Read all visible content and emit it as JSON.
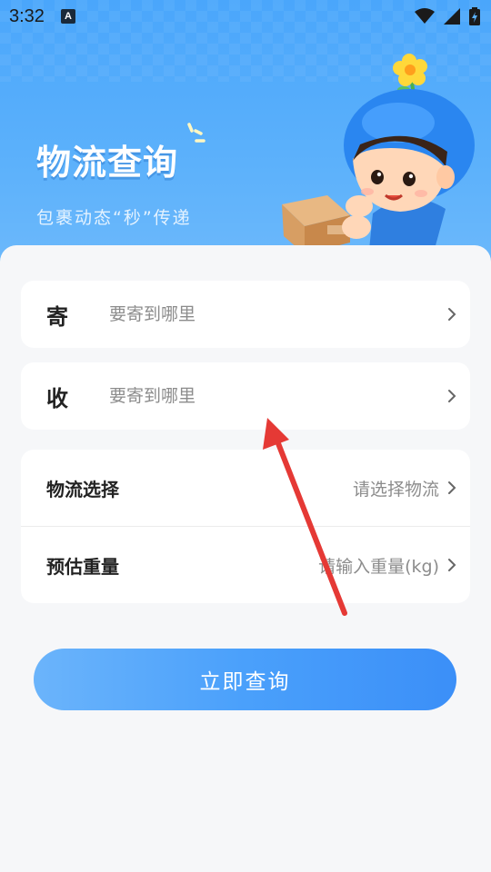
{
  "status_bar": {
    "time": "3:32",
    "indicator": "A"
  },
  "header": {
    "title": "物流查询",
    "subtitle": "包裹动态“秒”传递"
  },
  "send": {
    "key": "寄",
    "placeholder": "要寄到哪里"
  },
  "receive": {
    "key": "收",
    "placeholder": "要寄到哪里"
  },
  "logistics": {
    "label": "物流选择",
    "value": "请选择物流"
  },
  "weight": {
    "label": "预估重量",
    "value": "请输入重量(kg)"
  },
  "query_button": {
    "label": "立即查询"
  },
  "colors": {
    "primary": "#4aa0fb",
    "annotation_arrow": "#e53935"
  },
  "icons": [
    "wifi-icon",
    "signal-icon",
    "battery-icon",
    "chevron-right-icon"
  ]
}
